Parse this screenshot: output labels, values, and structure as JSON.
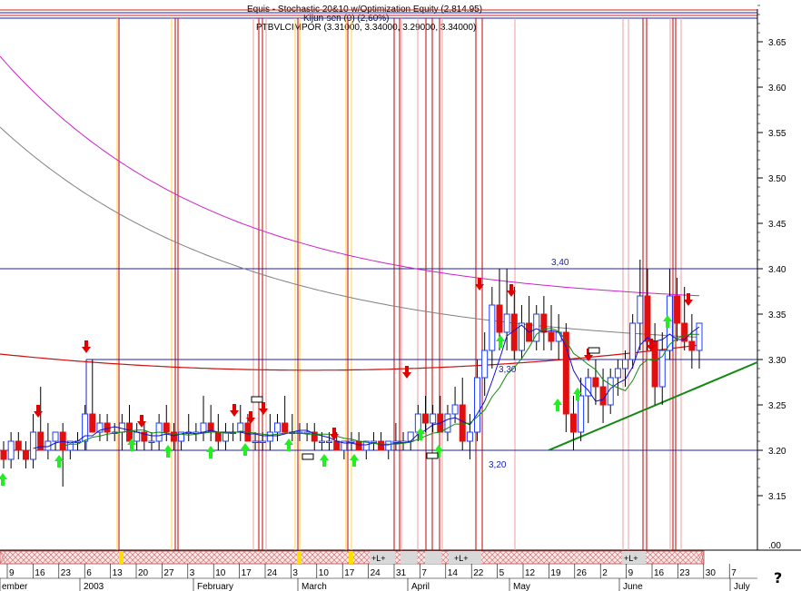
{
  "header": {
    "line1": "Equis - Stochastic 20&10 w/Optimization Equity (2,814.95)",
    "line2": "Kijun-sen (0) (2,60%)",
    "line3": "PTBVLCIMPOR (3.31000, 3.34000, 3.29000, 3.34000)"
  },
  "axis": {
    "y_ticks": [
      "3.65",
      "3.60",
      "3.55",
      "3.50",
      "3.45",
      "3.40",
      "3.35",
      "3.30",
      "3.25",
      "3.20",
      "3.15"
    ],
    "bottom_value": ".00",
    "x_ticks": [
      "9",
      "16",
      "23",
      "6",
      "13",
      "20",
      "27",
      "3",
      "10",
      "17",
      "24",
      "3",
      "10",
      "17",
      "24",
      "31",
      "7",
      "14",
      "22",
      "5",
      "12",
      "19",
      "26",
      "2",
      "9",
      "16",
      "23",
      "30",
      "7"
    ],
    "months": [
      "ember",
      "2003",
      "February",
      "March",
      "April",
      "May",
      "June",
      "July"
    ],
    "help": "?"
  },
  "annotations": {
    "resistance": "3,40",
    "mid": "3,30",
    "support": "3,20",
    "strip_marks": [
      "+L+",
      "+L+",
      "+L+"
    ]
  },
  "colors": {
    "up_candle": "#1a3cff",
    "down_candle": "#e01010",
    "buy_arrow": "#22ee22",
    "sell_arrow": "#e00000",
    "ma_long": "#cc22cc",
    "ma_mid": "#808080",
    "ma_red": "#cc1111",
    "ma_green": "#118811",
    "ma_blue": "#1111cc",
    "trendline": "#118811",
    "hline": "#2020aa",
    "vline_red": "#c00000",
    "vline_yellow": "#ffd040",
    "vline_pink": "#e8a0a0"
  },
  "chart_data": {
    "type": "candlestick",
    "symbol": "PTBVLCIMPOR",
    "y_range": [
      3.1,
      3.7
    ],
    "horizontal_levels": [
      3.4,
      3.3,
      3.2
    ],
    "trendline": {
      "from": {
        "x": "2003-05-12",
        "y": 3.2
      },
      "to": {
        "x": "2003-07-07",
        "y": 3.3
      }
    },
    "last_bar": {
      "open": 3.31,
      "high": 3.34,
      "low": 3.29,
      "close": 3.34
    },
    "dates_start": "2002-12-09",
    "candles": [
      [
        3.2,
        3.21,
        3.18,
        3.19
      ],
      [
        3.19,
        3.22,
        3.18,
        3.21
      ],
      [
        3.21,
        3.22,
        3.19,
        3.2
      ],
      [
        3.2,
        3.21,
        3.18,
        3.19
      ],
      [
        3.19,
        3.24,
        3.18,
        3.22
      ],
      [
        3.22,
        3.27,
        3.21,
        3.2
      ],
      [
        3.2,
        3.23,
        3.19,
        3.21
      ],
      [
        3.21,
        3.22,
        3.2,
        3.22
      ],
      [
        3.22,
        3.23,
        3.16,
        3.2
      ],
      [
        3.2,
        3.21,
        3.19,
        3.21
      ],
      [
        3.21,
        3.22,
        3.2,
        3.21
      ],
      [
        3.21,
        3.25,
        3.2,
        3.24
      ],
      [
        3.24,
        3.3,
        3.23,
        3.22
      ],
      [
        3.22,
        3.24,
        3.21,
        3.23
      ],
      [
        3.23,
        3.24,
        3.21,
        3.22
      ],
      [
        3.22,
        3.23,
        3.21,
        3.22
      ],
      [
        3.22,
        3.24,
        3.2,
        3.23
      ],
      [
        3.23,
        3.25,
        3.21,
        3.21
      ],
      [
        3.21,
        3.23,
        3.2,
        3.22
      ],
      [
        3.22,
        3.23,
        3.2,
        3.21
      ],
      [
        3.21,
        3.22,
        3.2,
        3.21
      ],
      [
        3.21,
        3.24,
        3.2,
        3.23
      ],
      [
        3.23,
        3.25,
        3.21,
        3.22
      ],
      [
        3.22,
        3.23,
        3.2,
        3.21
      ],
      [
        3.21,
        3.22,
        3.2,
        3.22
      ],
      [
        3.22,
        3.24,
        3.21,
        3.22
      ],
      [
        3.22,
        3.23,
        3.21,
        3.22
      ],
      [
        3.22,
        3.26,
        3.21,
        3.23
      ],
      [
        3.23,
        3.25,
        3.21,
        3.22
      ],
      [
        3.22,
        3.24,
        3.2,
        3.21
      ],
      [
        3.21,
        3.23,
        3.2,
        3.22
      ],
      [
        3.22,
        3.23,
        3.21,
        3.22
      ],
      [
        3.22,
        3.25,
        3.21,
        3.23
      ],
      [
        3.23,
        3.24,
        3.21,
        3.21
      ],
      [
        3.21,
        3.22,
        3.2,
        3.21
      ],
      [
        3.21,
        3.22,
        3.2,
        3.21
      ],
      [
        3.21,
        3.24,
        3.2,
        3.22
      ],
      [
        3.22,
        3.24,
        3.21,
        3.23
      ],
      [
        3.23,
        3.26,
        3.22,
        3.22
      ],
      [
        3.22,
        3.24,
        3.21,
        3.22
      ],
      [
        3.22,
        3.23,
        3.21,
        3.22
      ],
      [
        3.22,
        3.23,
        3.21,
        3.22
      ],
      [
        3.22,
        3.23,
        3.2,
        3.21
      ],
      [
        3.21,
        3.22,
        3.2,
        3.21
      ],
      [
        3.21,
        3.22,
        3.2,
        3.21
      ],
      [
        3.21,
        3.22,
        3.2,
        3.2
      ],
      [
        3.2,
        3.21,
        3.19,
        3.21
      ],
      [
        3.21,
        3.22,
        3.2,
        3.21
      ],
      [
        3.21,
        3.22,
        3.2,
        3.2
      ],
      [
        3.2,
        3.21,
        3.19,
        3.21
      ],
      [
        3.21,
        3.22,
        3.2,
        3.21
      ],
      [
        3.21,
        3.22,
        3.2,
        3.2
      ],
      [
        3.2,
        3.21,
        3.19,
        3.21
      ],
      [
        3.21,
        3.23,
        3.2,
        3.21
      ],
      [
        3.21,
        3.22,
        3.2,
        3.21
      ],
      [
        3.21,
        3.22,
        3.2,
        3.22
      ],
      [
        3.22,
        3.25,
        3.21,
        3.24
      ],
      [
        3.24,
        3.26,
        3.22,
        3.23
      ],
      [
        3.23,
        3.25,
        3.22,
        3.24
      ],
      [
        3.24,
        3.26,
        3.23,
        3.22
      ],
      [
        3.22,
        3.25,
        3.21,
        3.24
      ],
      [
        3.24,
        3.27,
        3.23,
        3.25
      ],
      [
        3.25,
        3.28,
        3.2,
        3.21
      ],
      [
        3.21,
        3.24,
        3.19,
        3.22
      ],
      [
        3.22,
        3.3,
        3.21,
        3.28
      ],
      [
        3.28,
        3.33,
        3.26,
        3.31
      ],
      [
        3.31,
        3.38,
        3.29,
        3.36
      ],
      [
        3.36,
        3.4,
        3.31,
        3.33
      ],
      [
        3.33,
        3.4,
        3.31,
        3.35
      ],
      [
        3.35,
        3.38,
        3.3,
        3.31
      ],
      [
        3.31,
        3.36,
        3.3,
        3.34
      ],
      [
        3.34,
        3.37,
        3.32,
        3.32
      ],
      [
        3.32,
        3.36,
        3.31,
        3.35
      ],
      [
        3.35,
        3.37,
        3.31,
        3.33
      ],
      [
        3.33,
        3.36,
        3.31,
        3.32
      ],
      [
        3.32,
        3.35,
        3.3,
        3.33
      ],
      [
        3.33,
        3.34,
        3.22,
        3.24
      ],
      [
        3.24,
        3.26,
        3.2,
        3.22
      ],
      [
        3.22,
        3.28,
        3.21,
        3.26
      ],
      [
        3.26,
        3.29,
        3.23,
        3.28
      ],
      [
        3.28,
        3.3,
        3.25,
        3.27
      ],
      [
        3.27,
        3.29,
        3.23,
        3.25
      ],
      [
        3.25,
        3.29,
        3.24,
        3.28
      ],
      [
        3.28,
        3.3,
        3.26,
        3.29
      ],
      [
        3.29,
        3.31,
        3.27,
        3.3
      ],
      [
        3.3,
        3.35,
        3.29,
        3.34
      ],
      [
        3.34,
        3.41,
        3.31,
        3.37
      ],
      [
        3.37,
        3.4,
        3.31,
        3.32
      ],
      [
        3.32,
        3.34,
        3.25,
        3.27
      ],
      [
        3.27,
        3.33,
        3.25,
        3.31
      ],
      [
        3.31,
        3.4,
        3.3,
        3.37
      ],
      [
        3.37,
        3.39,
        3.32,
        3.34
      ],
      [
        3.34,
        3.38,
        3.31,
        3.32
      ],
      [
        3.32,
        3.35,
        3.29,
        3.31
      ],
      [
        3.31,
        3.34,
        3.29,
        3.34
      ]
    ],
    "moving_averages": [
      {
        "color": "ma_long",
        "start": 3.65,
        "end": 3.37
      },
      {
        "color": "ma_mid",
        "start": 3.56,
        "end": 3.32
      },
      {
        "color": "ma_red",
        "start": 3.3,
        "end": 3.31
      }
    ]
  }
}
